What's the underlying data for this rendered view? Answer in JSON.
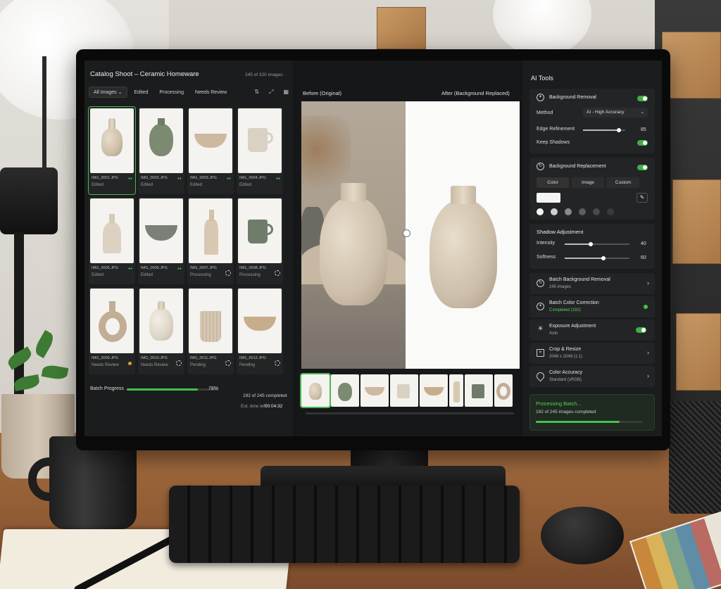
{
  "app": {
    "title": "Catalog Shoot – Ceramic Homeware",
    "image_count": "245 of 320 images"
  },
  "filters": [
    {
      "label": "All Images"
    },
    {
      "label": "Edited"
    },
    {
      "label": "Processing"
    },
    {
      "label": "Needs Review"
    }
  ],
  "filter_caret": "⌄",
  "grid": [
    {
      "file": "IMG_0001.JPG",
      "status": "Edited"
    },
    {
      "file": "IMG_0002.JPG",
      "status": "Edited"
    },
    {
      "file": "IMG_0003.JPG",
      "status": "Edited"
    },
    {
      "file": "IMG_0004.JPG",
      "status": "Edited"
    },
    {
      "file": "IMG_0005.JPG",
      "status": "Edited"
    },
    {
      "file": "IMG_0006.JPG",
      "status": "Edited"
    },
    {
      "file": "IMG_0007.JPG",
      "status": "Processing"
    },
    {
      "file": "IMG_0008.JPG",
      "status": "Processing"
    },
    {
      "file": "IMG_0009.JPG",
      "status": "Needs Review"
    },
    {
      "file": "IMG_0010.JPG",
      "status": "Needs Review"
    },
    {
      "file": "IMG_0011.JPG",
      "status": "Pending"
    },
    {
      "file": "IMG_0012.JPG",
      "status": "Pending"
    }
  ],
  "batch": {
    "label": "Batch Progress",
    "percent": 78,
    "percent_label": "78%",
    "completed": "192 of 245 completed",
    "eta_label": "Est. time left:",
    "eta": "00:04:32"
  },
  "preview": {
    "before_label": "Before (Original)",
    "after_label": "After (Background Replaced)"
  },
  "ai_tools": {
    "title": "AI Tools",
    "background_removal": {
      "title": "Background Removal",
      "method_label": "Method",
      "method_value": "AI - High Accuracy",
      "edge_label": "Edge Refinement",
      "edge_value": "85",
      "edge_level": 0.85,
      "shadows_label": "Keep Shadows"
    },
    "background_replacement": {
      "title": "Background Replacement",
      "tabs": [
        "Color",
        "Image",
        "Custom"
      ],
      "swatch_colors": [
        "#f4f4f2",
        "#cfcfcf",
        "#8a8a8a",
        "#5e5e5e",
        "#4a4a4a",
        "#3a3a3a"
      ]
    },
    "shadow": {
      "title": "Shadow Adjustment",
      "intensity_label": "Intensity",
      "intensity_value": "40",
      "intensity_level": 0.4,
      "softness_label": "Softness",
      "softness_value": "60",
      "softness_level": 0.6
    },
    "items": [
      {
        "title": "Batch Background Removal",
        "sub": "245 images"
      },
      {
        "title": "Batch Color Correction",
        "sub": "Completed (192)"
      },
      {
        "title": "Exposure Adjustment",
        "sub": "Auto"
      },
      {
        "title": "Crop & Resize",
        "sub": "2048 x 2048 (1:1)"
      },
      {
        "title": "Color Accuracy",
        "sub": "Standard (sRGB)"
      }
    ],
    "processing": {
      "title": "Processing Batch...",
      "sub": "192 of 245 images completed",
      "percent": 78
    }
  },
  "colors": {
    "accent": "#46c050",
    "warning": "#e0a22b",
    "panel": "#232425",
    "background": "#151617"
  },
  "icons": [
    "sort-icon",
    "expand-icon",
    "grid-view-icon",
    "eyedropper-icon",
    "chevron-right-icon",
    "sun-icon",
    "crop-icon",
    "droplet-icon",
    "sparkle-icon",
    "refresh-icon"
  ]
}
